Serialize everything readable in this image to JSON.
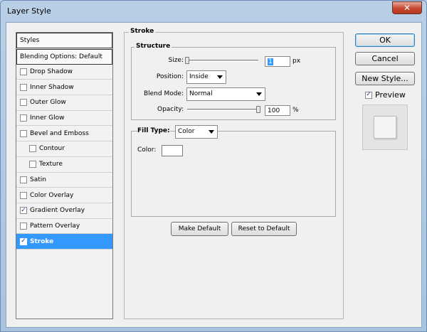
{
  "window": {
    "title": "Layer Style",
    "close_glyph": "✕"
  },
  "styles_list": {
    "header": "Styles",
    "blending_options": "Blending Options: Default",
    "items": [
      {
        "label": "Drop Shadow",
        "checked": false,
        "indent": false,
        "selected": false
      },
      {
        "label": "Inner Shadow",
        "checked": false,
        "indent": false,
        "selected": false
      },
      {
        "label": "Outer Glow",
        "checked": false,
        "indent": false,
        "selected": false
      },
      {
        "label": "Inner Glow",
        "checked": false,
        "indent": false,
        "selected": false
      },
      {
        "label": "Bevel and Emboss",
        "checked": false,
        "indent": false,
        "selected": false
      },
      {
        "label": "Contour",
        "checked": false,
        "indent": true,
        "selected": false
      },
      {
        "label": "Texture",
        "checked": false,
        "indent": true,
        "selected": false
      },
      {
        "label": "Satin",
        "checked": false,
        "indent": false,
        "selected": false
      },
      {
        "label": "Color Overlay",
        "checked": false,
        "indent": false,
        "selected": false
      },
      {
        "label": "Gradient Overlay",
        "checked": true,
        "indent": false,
        "selected": false
      },
      {
        "label": "Pattern Overlay",
        "checked": false,
        "indent": false,
        "selected": false
      },
      {
        "label": "Stroke",
        "checked": true,
        "indent": false,
        "selected": true
      }
    ]
  },
  "stroke": {
    "title": "Stroke",
    "structure": {
      "title": "Structure",
      "size_label": "Size:",
      "size_value": "1",
      "size_unit": "px",
      "size_fraction": 0.0,
      "position_label": "Position:",
      "position_value": "Inside",
      "blend_mode_label": "Blend Mode:",
      "blend_mode_value": "Normal",
      "opacity_label": "Opacity:",
      "opacity_value": "100",
      "opacity_unit": "%",
      "opacity_fraction": 1.0
    },
    "fill": {
      "fill_type_label": "Fill Type:",
      "fill_type_value": "Color",
      "color_label": "Color:",
      "color_value": "#ffffff"
    },
    "make_default": "Make Default",
    "reset_to_default": "Reset to Default"
  },
  "actions": {
    "ok": "OK",
    "cancel": "Cancel",
    "new_style": "New Style...",
    "preview_label": "Preview",
    "preview_checked": true,
    "check_glyph": "✓"
  },
  "colors": {
    "selection": "#3399ff",
    "panel": "#f0f0f0",
    "titlebar": "#b9cfe6",
    "close": "#c7462f"
  }
}
